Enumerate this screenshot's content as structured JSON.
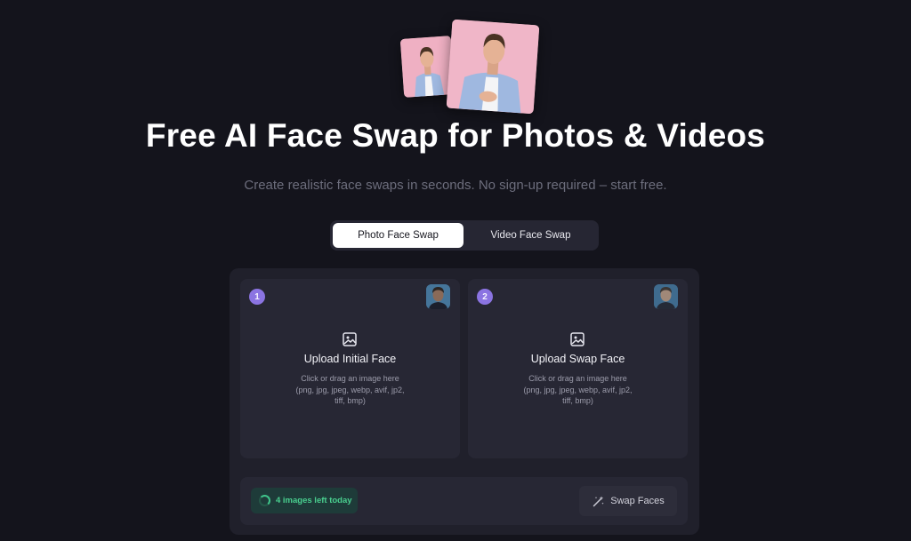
{
  "hero": {
    "title": "Free AI Face Swap for Photos & Videos",
    "subtitle": "Create realistic face swaps in seconds. No sign-up required – start free."
  },
  "tabs": [
    {
      "label": "Photo Face Swap",
      "active": true
    },
    {
      "label": "Video Face Swap",
      "active": false
    }
  ],
  "upload_cards": [
    {
      "step": "1",
      "title": "Upload Initial Face",
      "hint": "Click or drag an image here (png, jpg, jpeg, webp, avif, jp2, tiff, bmp)",
      "icon": "image-upload-icon"
    },
    {
      "step": "2",
      "title": "Upload Swap Face",
      "hint": "Click or drag an image here (png, jpg, jpeg, webp, avif, jp2, tiff, bmp)",
      "icon": "image-upload-icon"
    }
  ],
  "quota": {
    "text": "4 images left today",
    "icon": "spinner-icon"
  },
  "swap_button": {
    "label": "Swap Faces",
    "icon": "magic-wand-icon"
  },
  "colors": {
    "background": "#14141c",
    "panel": "#20202b",
    "card": "#272734",
    "accent_purple": "#8b74e2",
    "quota_green": "#49cf8f"
  }
}
